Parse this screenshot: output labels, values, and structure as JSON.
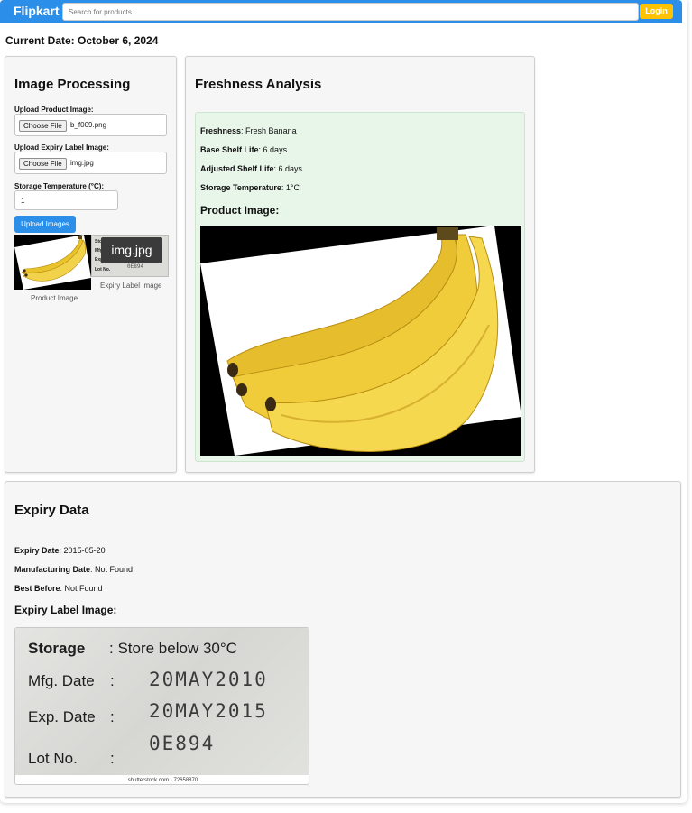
{
  "navbar": {
    "brand": "Flipkart",
    "search_placeholder": "Search for products...",
    "login_label": "Login"
  },
  "current_date": "Current Date: October 6, 2024",
  "image_processing": {
    "title": "Image Processing",
    "product_image_label": "Upload Product Image:",
    "product_choose_label": "Choose File",
    "product_file_name": "b_f009.png",
    "expiry_image_label": "Upload Expiry Label Image:",
    "expiry_choose_label": "Choose File",
    "expiry_file_name": "img.jpg",
    "temperature_label": "Storage Temperature (°C):",
    "temperature_value": "1",
    "tooltip_text": "img.jpg",
    "upload_button": "Upload Images",
    "product_caption": "Product Image",
    "expiry_caption": "Expiry Label Image"
  },
  "freshness": {
    "title": "Freshness Analysis",
    "freshness_key": "Freshness",
    "freshness_value": "Fresh Banana",
    "base_key": "Base Shelf Life",
    "base_value": "6 days",
    "adjusted_key": "Adjusted Shelf Life",
    "adjusted_value": "6 days",
    "storage_key": "Storage Temperature",
    "storage_value": "1°C",
    "product_image_heading": "Product Image:"
  },
  "expiry": {
    "title": "Expiry Data",
    "expiry_key": "Expiry Date",
    "expiry_value": "2015-05-20",
    "mfg_key": "Manufacturing Date",
    "mfg_value": "Not Found",
    "best_key": "Best Before",
    "best_value": "Not Found",
    "label_image_heading": "Expiry Label Image:"
  },
  "label_photo": {
    "storage_key": "Storage",
    "storage_value": ": Store below 30°C",
    "mfg_key": "Mfg. Date",
    "mfg_value": "20MAY2010",
    "exp_key": "Exp. Date",
    "exp_value": "20MAY2015",
    "lot_key": "Lot No.",
    "lot_value": "0E894",
    "colon": ":",
    "credit": "shutterstock.com · 72658870"
  },
  "colors": {
    "primary": "#2b8fe9",
    "accent": "#ffc200",
    "freshness_bg": "#e8f5e9"
  }
}
